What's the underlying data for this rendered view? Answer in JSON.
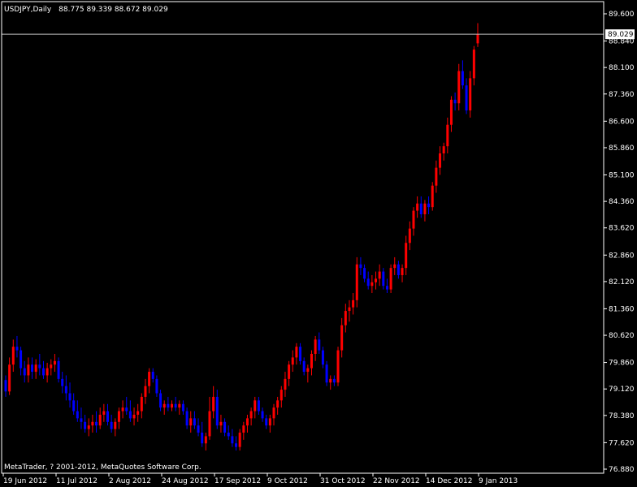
{
  "header": {
    "symbol_timeframe": "USDJPY,Daily",
    "ohlc": "88.775 89.339 88.672 89.029"
  },
  "copyright": "MetaTrader, ? 2001-2012, MetaQuotes Software Corp.",
  "current_price": "89.029",
  "colors": {
    "background": "#000000",
    "bull": "#ff0000",
    "bear": "#0000ff",
    "frame": "#ffffff",
    "price_line": "#c0c0c0"
  },
  "chart_data": {
    "type": "candlestick",
    "title": "USDJPY,Daily",
    "ylim": [
      76.88,
      89.6
    ],
    "grid": false,
    "y_ticks": [
      "89.600",
      "88.840",
      "88.100",
      "87.360",
      "86.600",
      "85.860",
      "85.100",
      "84.360",
      "83.620",
      "82.860",
      "82.120",
      "81.360",
      "80.620",
      "79.860",
      "79.120",
      "78.380",
      "77.620",
      "76.880"
    ],
    "x_ticks": [
      "19 Jun 2012",
      "11 Jul 2012",
      "2 Aug 2012",
      "24 Aug 2012",
      "17 Sep 2012",
      "9 Oct 2012",
      "31 Oct 2012",
      "22 Nov 2012",
      "14 Dec 2012",
      "9 Jan 2013"
    ],
    "series": [
      {
        "values": [
          [
            79.37,
            79.5,
            78.9,
            79.05
          ],
          [
            79.05,
            80.0,
            78.95,
            79.8
          ],
          [
            79.8,
            80.5,
            79.6,
            80.3
          ],
          [
            80.3,
            80.6,
            80.0,
            80.2
          ],
          [
            80.2,
            80.3,
            79.5,
            79.7
          ],
          [
            79.7,
            79.9,
            79.3,
            79.5
          ],
          [
            79.5,
            80.0,
            79.3,
            79.8
          ],
          [
            79.8,
            80.0,
            79.4,
            79.6
          ],
          [
            79.6,
            79.95,
            79.4,
            79.8
          ],
          [
            79.8,
            80.1,
            79.5,
            79.7
          ],
          [
            79.7,
            79.9,
            79.4,
            79.5
          ],
          [
            79.5,
            79.85,
            79.3,
            79.7
          ],
          [
            79.7,
            79.95,
            79.5,
            79.8
          ],
          [
            79.8,
            80.1,
            79.6,
            79.9
          ],
          [
            79.9,
            80.0,
            79.3,
            79.4
          ],
          [
            79.4,
            79.6,
            79.0,
            79.2
          ],
          [
            79.2,
            79.5,
            78.8,
            79.0
          ],
          [
            79.0,
            79.3,
            78.6,
            78.8
          ],
          [
            78.8,
            79.0,
            78.4,
            78.5
          ],
          [
            78.5,
            78.8,
            78.2,
            78.3
          ],
          [
            78.3,
            78.6,
            78.0,
            78.2
          ],
          [
            78.2,
            78.4,
            77.9,
            78.0
          ],
          [
            78.0,
            78.3,
            77.8,
            78.1
          ],
          [
            78.1,
            78.4,
            77.9,
            78.2
          ],
          [
            78.2,
            78.5,
            77.9,
            78.1
          ],
          [
            78.1,
            78.6,
            78.0,
            78.4
          ],
          [
            78.4,
            78.7,
            78.2,
            78.5
          ],
          [
            78.5,
            78.7,
            78.1,
            78.2
          ],
          [
            78.2,
            78.4,
            77.9,
            78.0
          ],
          [
            78.0,
            78.3,
            77.8,
            78.2
          ],
          [
            78.2,
            78.6,
            78.0,
            78.5
          ],
          [
            78.5,
            78.8,
            78.3,
            78.6
          ],
          [
            78.6,
            78.9,
            78.4,
            78.5
          ],
          [
            78.5,
            78.8,
            78.2,
            78.3
          ],
          [
            78.3,
            78.6,
            78.1,
            78.4
          ],
          [
            78.4,
            78.7,
            78.2,
            78.5
          ],
          [
            78.5,
            79.0,
            78.3,
            78.9
          ],
          [
            78.9,
            79.4,
            78.7,
            79.2
          ],
          [
            79.2,
            79.7,
            79.0,
            79.6
          ],
          [
            79.6,
            79.7,
            79.3,
            79.4
          ],
          [
            79.4,
            79.5,
            78.9,
            79.0
          ],
          [
            79.0,
            79.1,
            78.5,
            78.6
          ],
          [
            78.6,
            78.8,
            78.4,
            78.7
          ],
          [
            78.7,
            78.9,
            78.5,
            78.6
          ],
          [
            78.6,
            78.8,
            78.5,
            78.7
          ],
          [
            78.7,
            78.9,
            78.5,
            78.6
          ],
          [
            78.6,
            78.8,
            78.4,
            78.7
          ],
          [
            78.7,
            78.8,
            78.4,
            78.5
          ],
          [
            78.5,
            78.6,
            78.0,
            78.1
          ],
          [
            78.1,
            78.5,
            77.9,
            78.3
          ],
          [
            78.3,
            78.5,
            78.0,
            78.1
          ],
          [
            78.1,
            78.3,
            77.8,
            77.9
          ],
          [
            77.9,
            78.2,
            77.5,
            77.6
          ],
          [
            77.6,
            77.9,
            77.4,
            77.8
          ],
          [
            77.8,
            78.9,
            77.7,
            78.5
          ],
          [
            78.5,
            79.2,
            78.3,
            78.9
          ],
          [
            78.9,
            79.1,
            78.0,
            78.1
          ],
          [
            78.1,
            78.4,
            77.9,
            78.2
          ],
          [
            78.2,
            78.3,
            77.8,
            77.9
          ],
          [
            77.9,
            78.1,
            77.7,
            77.8
          ],
          [
            77.8,
            78.0,
            77.5,
            77.6
          ],
          [
            77.6,
            77.8,
            77.4,
            77.5
          ],
          [
            77.5,
            78.0,
            77.4,
            77.9
          ],
          [
            77.9,
            78.2,
            77.7,
            78.1
          ],
          [
            78.1,
            78.4,
            77.9,
            78.3
          ],
          [
            78.3,
            78.6,
            78.1,
            78.5
          ],
          [
            78.5,
            78.9,
            78.3,
            78.8
          ],
          [
            78.8,
            78.9,
            78.4,
            78.5
          ],
          [
            78.5,
            78.6,
            78.2,
            78.3
          ],
          [
            78.3,
            78.4,
            78.0,
            78.1
          ],
          [
            78.1,
            78.4,
            77.9,
            78.3
          ],
          [
            78.3,
            78.7,
            78.1,
            78.6
          ],
          [
            78.6,
            78.9,
            78.4,
            78.8
          ],
          [
            78.8,
            79.2,
            78.6,
            79.1
          ],
          [
            79.1,
            79.6,
            78.9,
            79.4
          ],
          [
            79.4,
            79.9,
            79.2,
            79.8
          ],
          [
            79.8,
            80.2,
            79.6,
            80.0
          ],
          [
            80.0,
            80.4,
            79.8,
            80.3
          ],
          [
            80.3,
            80.4,
            79.8,
            79.9
          ],
          [
            79.9,
            80.0,
            79.5,
            79.6
          ],
          [
            79.6,
            79.8,
            79.3,
            79.7
          ],
          [
            79.7,
            80.2,
            79.5,
            80.1
          ],
          [
            80.1,
            80.6,
            79.9,
            80.5
          ],
          [
            80.5,
            80.7,
            80.1,
            80.2
          ],
          [
            80.2,
            80.3,
            79.7,
            79.8
          ],
          [
            79.8,
            79.9,
            79.2,
            79.3
          ],
          [
            79.3,
            79.5,
            79.1,
            79.4
          ],
          [
            79.4,
            79.5,
            79.2,
            79.3
          ],
          [
            79.3,
            80.3,
            79.2,
            80.2
          ],
          [
            80.2,
            81.1,
            80.0,
            80.9
          ],
          [
            80.9,
            81.5,
            80.7,
            81.3
          ],
          [
            81.3,
            81.6,
            81.0,
            81.4
          ],
          [
            81.4,
            81.8,
            81.2,
            81.6
          ],
          [
            81.6,
            82.8,
            81.4,
            82.6
          ],
          [
            82.6,
            82.8,
            82.3,
            82.5
          ],
          [
            82.5,
            82.6,
            82.1,
            82.2
          ],
          [
            82.2,
            82.4,
            81.9,
            82.0
          ],
          [
            82.0,
            82.3,
            81.8,
            82.1
          ],
          [
            82.1,
            82.4,
            81.9,
            82.2
          ],
          [
            82.2,
            82.6,
            82.0,
            82.4
          ],
          [
            82.4,
            82.5,
            81.9,
            82.0
          ],
          [
            82.0,
            82.2,
            81.8,
            81.9
          ],
          [
            81.9,
            82.6,
            81.8,
            82.5
          ],
          [
            82.5,
            82.8,
            82.3,
            82.6
          ],
          [
            82.6,
            82.7,
            82.2,
            82.3
          ],
          [
            82.3,
            82.6,
            82.1,
            82.5
          ],
          [
            82.5,
            83.4,
            82.3,
            83.2
          ],
          [
            83.2,
            83.8,
            83.0,
            83.6
          ],
          [
            83.6,
            84.2,
            83.4,
            84.1
          ],
          [
            84.1,
            84.5,
            83.9,
            84.3
          ],
          [
            84.3,
            84.5,
            83.9,
            84.0
          ],
          [
            84.0,
            84.4,
            83.8,
            84.3
          ],
          [
            84.3,
            84.5,
            84.0,
            84.2
          ],
          [
            84.2,
            84.9,
            84.1,
            84.8
          ],
          [
            84.8,
            85.5,
            84.6,
            85.3
          ],
          [
            85.3,
            85.9,
            85.1,
            85.7
          ],
          [
            85.7,
            86.0,
            85.5,
            85.9
          ],
          [
            85.9,
            86.7,
            85.7,
            86.5
          ],
          [
            86.5,
            87.3,
            86.3,
            87.2
          ],
          [
            87.2,
            87.4,
            86.9,
            87.1
          ],
          [
            87.1,
            88.2,
            86.9,
            88.0
          ],
          [
            88.0,
            88.3,
            87.5,
            87.6
          ],
          [
            87.6,
            87.8,
            86.8,
            86.9
          ],
          [
            86.9,
            88.0,
            86.7,
            87.8
          ],
          [
            87.8,
            88.7,
            87.6,
            88.6
          ],
          [
            88.775,
            89.339,
            88.672,
            89.029
          ]
        ]
      }
    ]
  }
}
